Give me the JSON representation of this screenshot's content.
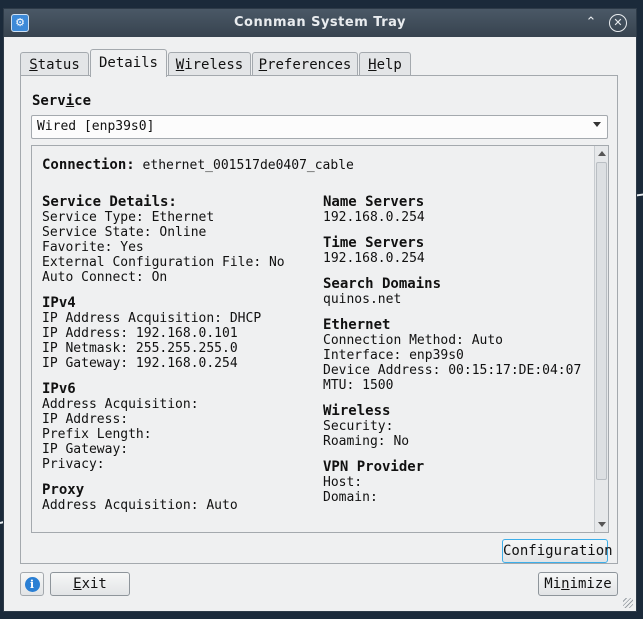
{
  "window": {
    "title": "Connman System Tray",
    "app_icon_glyph": "⚙",
    "keep_above_glyph": "⌃",
    "close_glyph": "✕"
  },
  "tabs": [
    {
      "pre": "",
      "u": "S",
      "post": "tatus"
    },
    {
      "pre": "",
      "u": "",
      "post": "Details"
    },
    {
      "pre": "",
      "u": "W",
      "post": "ireless"
    },
    {
      "pre": "",
      "u": "P",
      "post": "references"
    },
    {
      "pre": "",
      "u": "H",
      "post": "elp"
    }
  ],
  "service": {
    "label_pre": "Serv",
    "label_u": "i",
    "label_post": "ce",
    "selected": "Wired [enp39s0]"
  },
  "details": {
    "connection_label": "Connection:",
    "connection_value": "ethernet_001517de0407_cable",
    "left": [
      {
        "heading": "Service Details:",
        "rows": [
          "Service Type: Ethernet",
          "Service State: Online",
          "Favorite: Yes",
          "External Configuration File: No",
          "Auto Connect: On"
        ]
      },
      {
        "heading": "IPv4",
        "rows": [
          "IP Address Acquisition: DHCP",
          "IP Address: 192.168.0.101",
          "IP Netmask: 255.255.255.0",
          "IP Gateway: 192.168.0.254"
        ]
      },
      {
        "heading": "IPv6",
        "rows": [
          "Address Acquisition:",
          "IP Address:",
          "Prefix Length:",
          "IP Gateway:",
          "Privacy:"
        ]
      },
      {
        "heading": "Proxy",
        "rows": [
          "Address Acquisition: Auto"
        ]
      }
    ],
    "right": [
      {
        "heading": "Name Servers",
        "rows": [
          "192.168.0.254"
        ]
      },
      {
        "heading": "Time Servers",
        "rows": [
          "192.168.0.254"
        ]
      },
      {
        "heading": "Search Domains",
        "rows": [
          "quinos.net"
        ]
      },
      {
        "heading": "Ethernet",
        "rows": [
          "Connection Method: Auto",
          "Interface: enp39s0",
          "Device Address: 00:15:17:DE:04:07",
          "MTU: 1500"
        ]
      },
      {
        "heading": "Wireless",
        "rows": [
          "Security:",
          "Roaming: No"
        ]
      },
      {
        "heading": "VPN Provider",
        "rows": [
          "Host:",
          "Domain:"
        ]
      }
    ]
  },
  "buttons": {
    "configuration": "Configuration",
    "info_glyph": "i",
    "exit_u": "E",
    "exit_post": "xit",
    "minimize_pre": "Mi",
    "minimize_u": "n",
    "minimize_post": "imize"
  }
}
